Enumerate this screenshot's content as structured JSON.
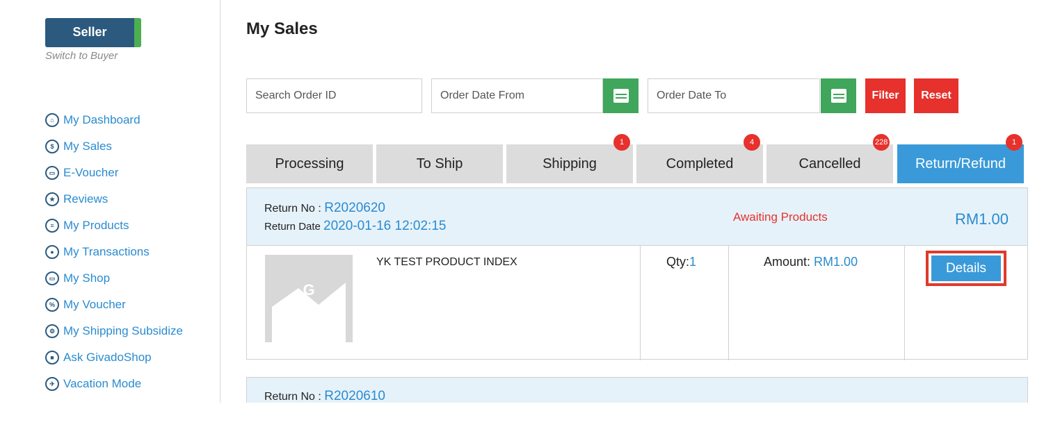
{
  "sidebar": {
    "seller_label": "Seller",
    "switch_label": "Switch to Buyer",
    "items": [
      {
        "label": "My Dashboard",
        "icon": "home-icon"
      },
      {
        "label": "My Sales",
        "icon": "sales-icon"
      },
      {
        "label": "E-Voucher",
        "icon": "evoucher-icon"
      },
      {
        "label": "Reviews",
        "icon": "star-icon"
      },
      {
        "label": "My Products",
        "icon": "products-icon"
      },
      {
        "label": "My Transactions",
        "icon": "transactions-icon"
      },
      {
        "label": "My Shop",
        "icon": "shop-icon"
      },
      {
        "label": "My Voucher",
        "icon": "voucher-icon"
      },
      {
        "label": "My Shipping Subsidize",
        "icon": "shipping-subsidy-icon"
      },
      {
        "label": "Ask GivadoShop",
        "icon": "chat-icon"
      },
      {
        "label": "Vacation Mode",
        "icon": "plane-icon"
      }
    ]
  },
  "page": {
    "title": "My Sales"
  },
  "filters": {
    "search_placeholder": "Search Order ID",
    "date_from_placeholder": "Order Date From",
    "date_to_placeholder": "Order Date To",
    "filter_label": "Filter",
    "reset_label": "Reset"
  },
  "tabs": [
    {
      "label": "Processing",
      "badge": ""
    },
    {
      "label": "To Ship",
      "badge": ""
    },
    {
      "label": "Shipping",
      "badge": "1"
    },
    {
      "label": "Completed",
      "badge": "4"
    },
    {
      "label": "Cancelled",
      "badge": "228"
    },
    {
      "label": "Return/Refund",
      "badge": "1"
    }
  ],
  "returns": [
    {
      "return_no_label": "Return No : ",
      "return_no": "R2020620",
      "return_date_label": "Return Date ",
      "return_date": "2020-01-16 12:02:15",
      "status": "Awaiting Products",
      "total": "RM1.00",
      "product": {
        "name": "YK TEST PRODUCT INDEX"
      },
      "qty_label": "Qty:",
      "qty": "1",
      "amount_label": "Amount: ",
      "amount": "RM1.00",
      "details_label": "Details"
    },
    {
      "return_no_label": "Return No : ",
      "return_no": "R2020610"
    }
  ],
  "colors": {
    "accent_blue": "#3a9ad9",
    "link_blue": "#2a8bd0",
    "danger_red": "#e6312c",
    "calendar_green": "#3fa65c",
    "seller_navy": "#2b5a7e"
  }
}
